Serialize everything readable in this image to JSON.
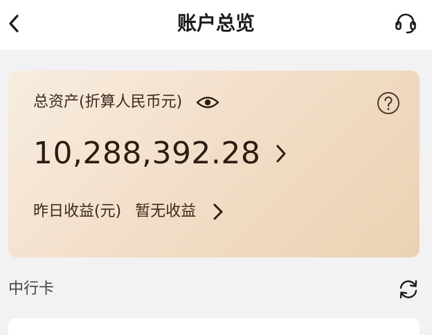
{
  "header": {
    "title": "账户总览",
    "back_icon": "chevron-left-icon",
    "service_icon": "headset-icon"
  },
  "asset_card": {
    "label": "总资产(折算人民币元)",
    "eye_icon": "eye-icon",
    "help_icon": "question-circle-icon",
    "total_amount": "10,288,392.28",
    "yesterday_profit_label": "昨日收益(元)",
    "yesterday_profit_value": "暂无收益",
    "gradient_colors": [
      "#f8ede0",
      "#ecd1b4"
    ]
  },
  "section": {
    "title": "中行卡",
    "refresh_icon": "refresh-icon"
  }
}
